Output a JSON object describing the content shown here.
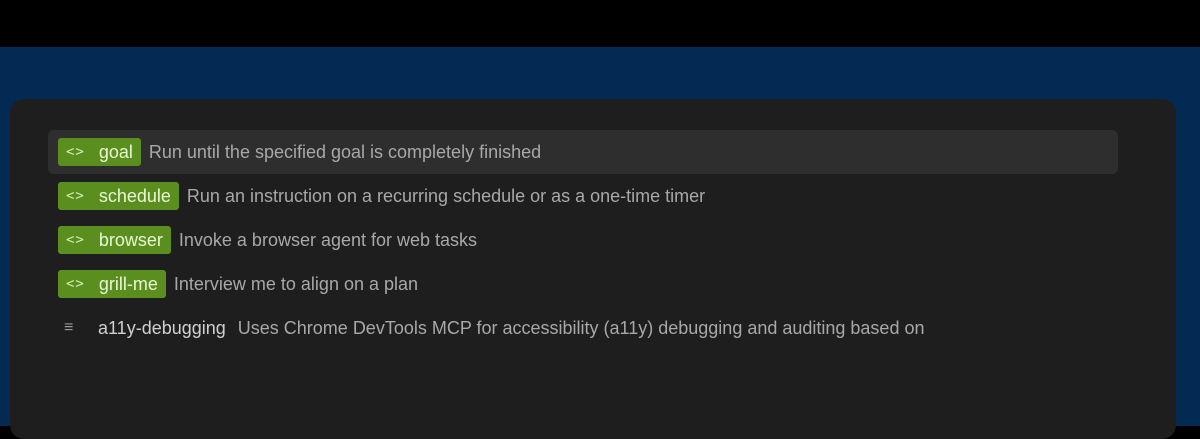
{
  "commands": [
    {
      "icon": "code-icon",
      "glyph": "<>",
      "name": "goal",
      "description": "Run until the specified goal is completely finished",
      "selected": true
    },
    {
      "icon": "code-icon",
      "glyph": "<>",
      "name": "schedule",
      "description": "Run an instruction on a recurring schedule or as a one-time timer",
      "selected": false
    },
    {
      "icon": "code-icon",
      "glyph": "<>",
      "name": "browser",
      "description": "Invoke a browser agent for web tasks",
      "selected": false
    },
    {
      "icon": "code-icon",
      "glyph": "<>",
      "name": "grill-me",
      "description": "Interview me to align on a plan",
      "selected": false
    },
    {
      "icon": "menu-lines-icon",
      "glyph": "≡",
      "name": "a11y-debugging",
      "description": "Uses Chrome DevTools MCP for accessibility (a11y) debugging and auditing based on",
      "selected": false
    }
  ],
  "colors": {
    "tag_bg": "#5a8f1f",
    "panel_bg": "#1e1e1e",
    "desktop_bg": "#032a52",
    "selected_row": "#2e2e2e"
  }
}
